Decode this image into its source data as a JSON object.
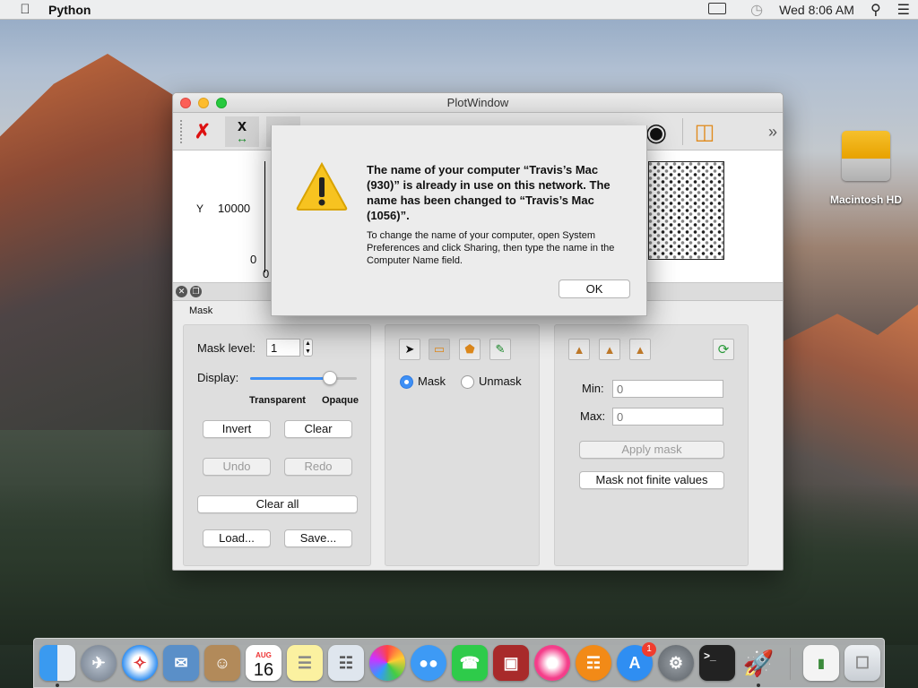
{
  "menubar": {
    "app_name": "Python",
    "clock": "Wed 8:06 AM",
    "apple_glyph": ""
  },
  "desktop": {
    "drive_label": "Macintosh HD"
  },
  "window": {
    "title": "PlotWindow"
  },
  "plot": {
    "ylabel": "Y",
    "ytick_high": "10000",
    "ytick_low": "0",
    "xtick": "0"
  },
  "mask_panel": {
    "title": "Mask",
    "mask_level_label": "Mask level:",
    "mask_level_value": "1",
    "display_label": "Display:",
    "display_level": 0.75,
    "transparent_label": "Transparent",
    "opaque_label": "Opaque",
    "invert": "Invert",
    "clear": "Clear",
    "undo": "Undo",
    "redo": "Redo",
    "clear_all": "Clear all",
    "load": "Load...",
    "save": "Save..."
  },
  "draw_panel": {
    "mask_label": "Mask",
    "unmask_label": "Unmask"
  },
  "range_panel": {
    "min_label": "Min:",
    "min_value": "0",
    "max_label": "Max:",
    "max_value": "0",
    "apply_mask": "Apply mask",
    "mask_not_finite": "Mask not finite values"
  },
  "alert": {
    "title": "The name of your computer “Travis’s Mac (930)” is already in use on this network. The name has been changed to “Travis’s Mac (1056)”.",
    "body": "To change the name of your computer, open System Preferences and click Sharing, then type the name in the Computer Name field.",
    "ok": "OK"
  },
  "dock": {
    "calendar_month": "AUG",
    "calendar_day": "16",
    "appstore_badge": "1"
  }
}
